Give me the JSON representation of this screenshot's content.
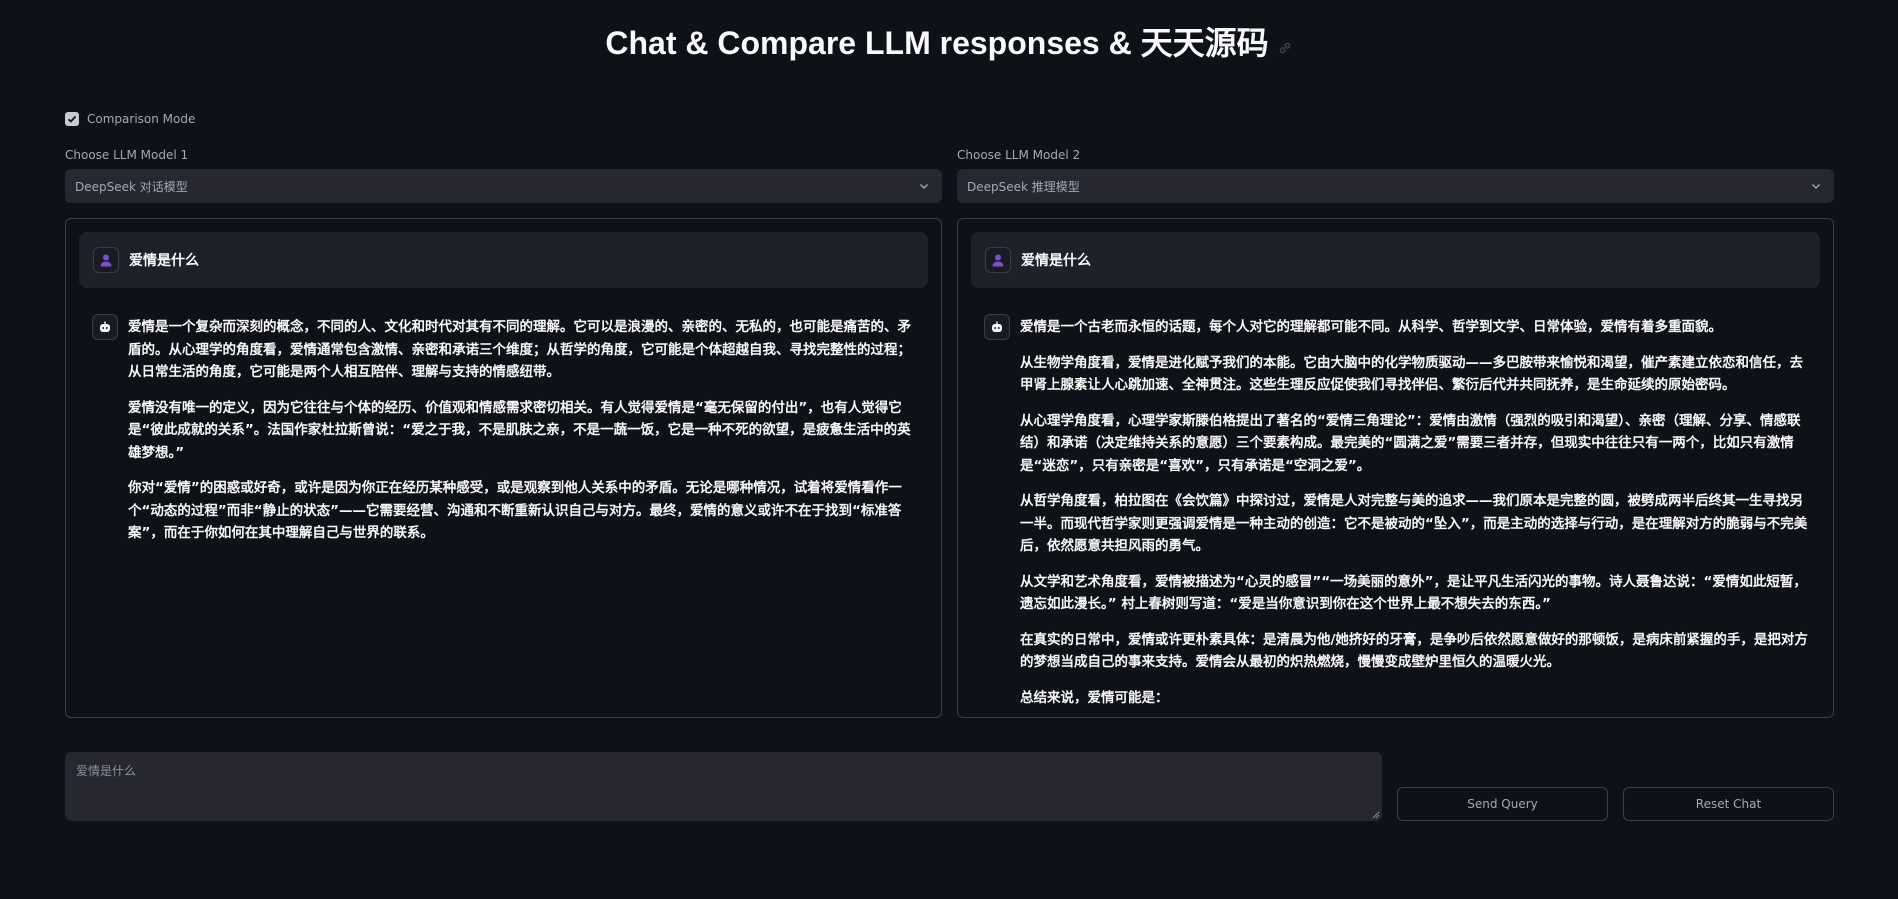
{
  "header": {
    "title": "Chat & Compare LLM responses & 天天源码",
    "link_icon": "link-icon"
  },
  "comparison_mode": {
    "label": "Comparison Mode",
    "checked": true
  },
  "model1": {
    "label": "Choose LLM Model 1",
    "value": "DeepSeek 对话模型"
  },
  "model2": {
    "label": "Choose LLM Model 2",
    "value": "DeepSeek 推理模型"
  },
  "panel1": {
    "user_message": "爱情是什么",
    "paragraphs": [
      "爱情是一个复杂而深刻的概念，不同的人、文化和时代对其有不同的理解。它可以是浪漫的、亲密的、无私的，也可能是痛苦的、矛盾的。从心理学的角度看，爱情通常包含激情、亲密和承诺三个维度；从哲学的角度，它可能是个体超越自我、寻找完整性的过程；从日常生活的角度，它可能是两个人相互陪伴、理解与支持的情感纽带。",
      "爱情没有唯一的定义，因为它往往与个体的经历、价值观和情感需求密切相关。有人觉得爱情是“毫无保留的付出”，也有人觉得它是“彼此成就的关系”。法国作家杜拉斯曾说：“爱之于我，不是肌肤之亲，不是一蔬一饭，它是一种不死的欲望，是疲惫生活中的英雄梦想。”",
      "你对“爱情”的困惑或好奇，或许是因为你正在经历某种感受，或是观察到他人关系中的矛盾。无论是哪种情况，试着将爱情看作一个“动态的过程”而非“静止的状态”——它需要经营、沟通和不断重新认识自己与对方。最终，爱情的意义或许不在于找到“标准答案”，而在于你如何在其中理解自己与世界的联系。"
    ]
  },
  "panel2": {
    "user_message": "爱情是什么",
    "intro": "爱情是一个古老而永恒的话题，每个人对它的理解都可能不同。从科学、哲学到文学、日常体验，爱情有着多重面貌。",
    "sections": [
      {
        "head": "从生物学角度看",
        "text": "，爱情是进化赋予我们的本能。它由大脑中的化学物质驱动——多巴胺带来愉悦和渴望，催产素建立依恋和信任，去甲肾上腺素让人心跳加速、全神贯注。这些生理反应促使我们寻找伴侣、繁衍后代并共同抚养，是生命延续的原始密码。"
      },
      {
        "head": "从心理学角度看",
        "text": "，心理学家斯滕伯格提出了著名的“爱情三角理论”：爱情由激情（强烈的吸引和渴望）、亲密（理解、分享、情感联结）和承诺（决定维持关系的意愿）三个要素构成。最完美的“圆满之爱”需要三者并存，但现实中往往只有一两个，比如只有激情是“迷恋”，只有亲密是“喜欢”，只有承诺是“空洞之爱”。"
      },
      {
        "head": "从哲学角度看",
        "text": "，柏拉图在《会饮篇》中探讨过，爱情是人对完整与美的追求——我们原本是完整的圆，被劈成两半后终其一生寻找另一半。而现代哲学家则更强调爱情是一种主动的创造：它不是被动的“坠入”，而是主动的选择与行动，是在理解对方的脆弱与不完美后，依然愿意共担风雨的勇气。"
      },
      {
        "head": "从文学和艺术角度看",
        "text": "，爱情被描述为“心灵的感冒”“一场美丽的意外”，是让平凡生活闪光的事物。诗人聂鲁达说：“爱情如此短暂，遗忘如此漫长。” 村上春树则写道：“爱是当你意识到你在这个世界上最不想失去的东西。”"
      },
      {
        "head": "在真实的日常中",
        "text": "，爱情或许更朴素具体：是清晨为他/她挤好的牙膏，是争吵后依然愿意做好的那顿饭，是病床前紧握的手，是把对方的梦想当成自己的事来支持。爱情会从最初的炽热燃烧，慢慢变成壁炉里恒久的温暖火光。"
      },
      {
        "head": "总结来说",
        "text": "，爱情可能是："
      }
    ]
  },
  "query": {
    "placeholder": "爱情是什么"
  },
  "buttons": {
    "send": "Send Query",
    "reset": "Reset Chat"
  },
  "colors": {
    "background": "#0e1117",
    "surface": "#262730",
    "border": "#3b3d47",
    "avatar_user": "#7b4fc9"
  }
}
